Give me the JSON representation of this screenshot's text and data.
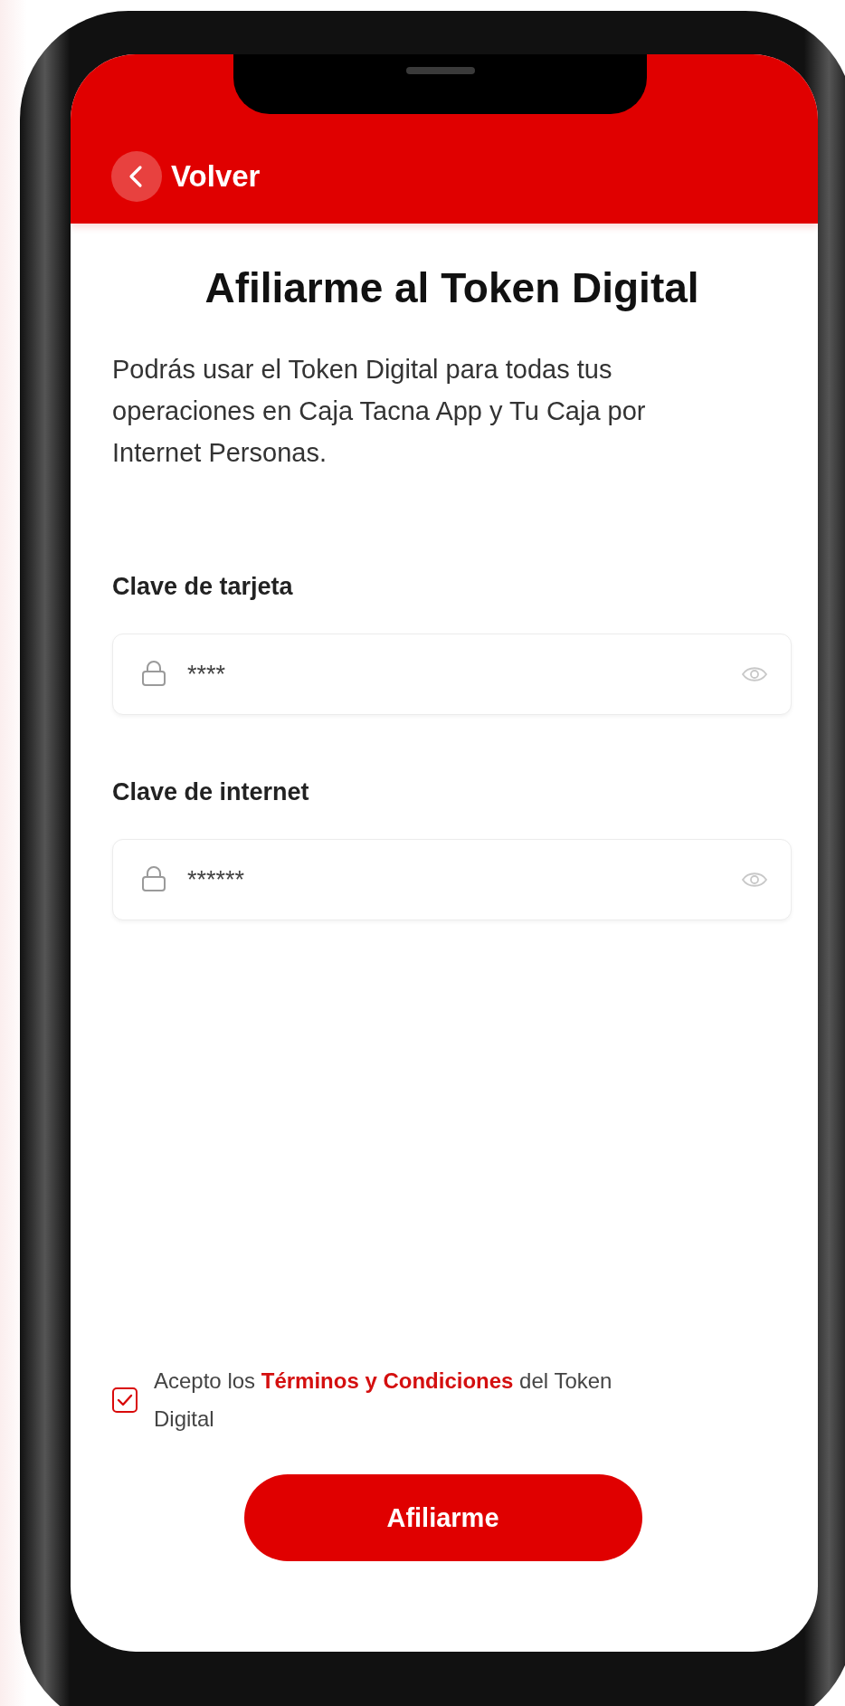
{
  "header": {
    "back_label": "Volver"
  },
  "title": "Afiliarme al Token Digital",
  "description": "Podrás usar el Token Digital para todas tus operaciones en Caja Tacna App y Tu Caja por Internet Personas.",
  "fields": [
    {
      "label": "Clave de tarjeta",
      "value": "****"
    },
    {
      "label": "Clave de internet",
      "value": "******"
    }
  ],
  "terms": {
    "checked": true,
    "before": "Acepto los",
    "link": "Términos y Condiciones",
    "after": "del Token Digital"
  },
  "submit": "Afiliarme"
}
